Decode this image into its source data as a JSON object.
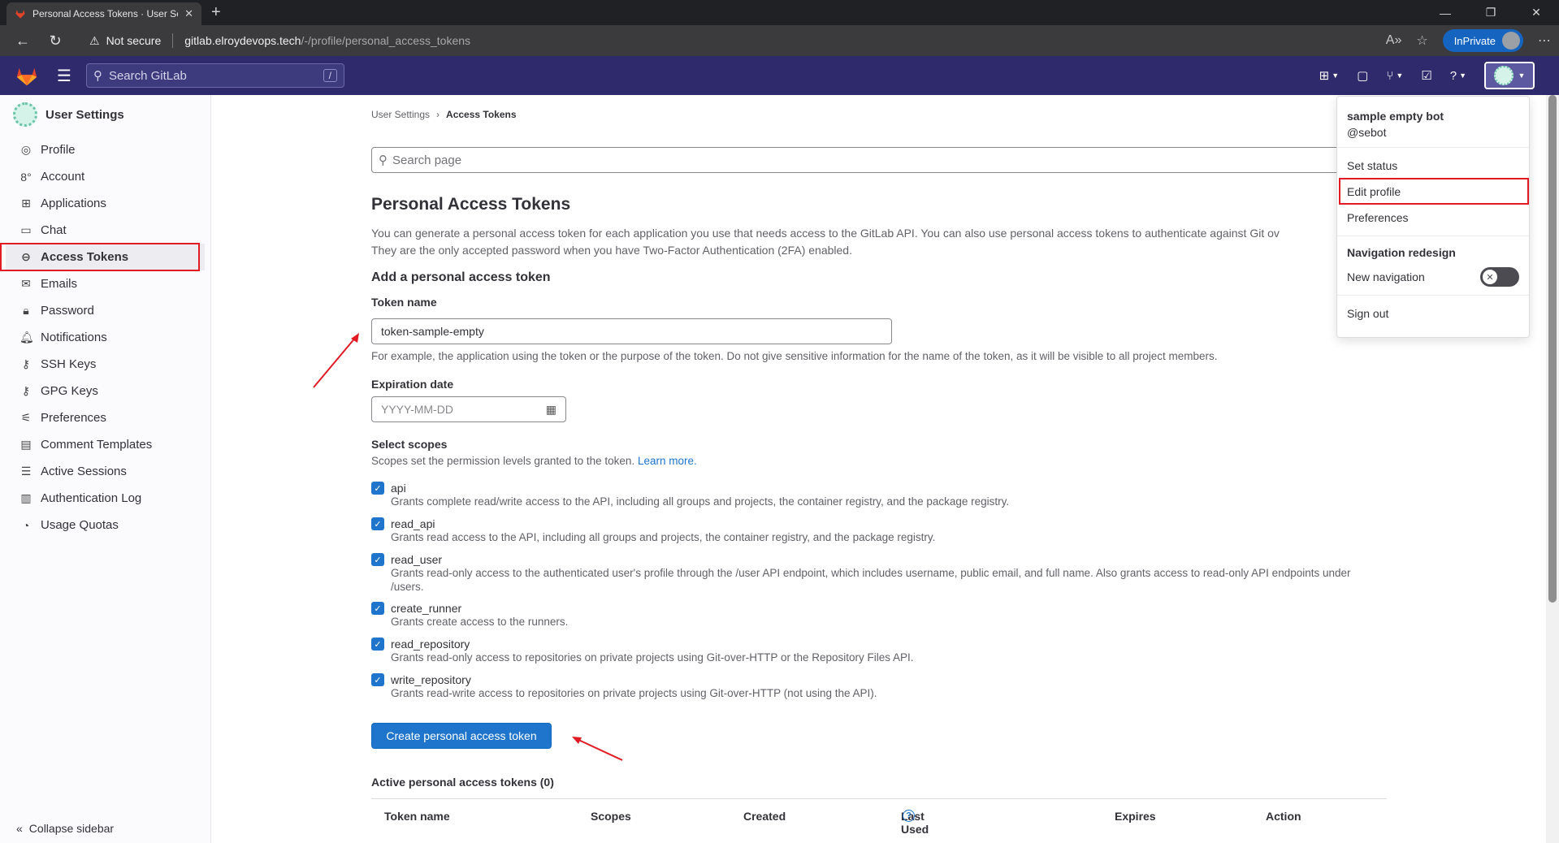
{
  "browser": {
    "tab_title": "Personal Access Tokens · User Se",
    "security_label": "Not secure",
    "url_host": "gitlab.elroydevops.tech",
    "url_path": "/-/profile/personal_access_tokens",
    "inprivate_label": "InPrivate"
  },
  "header": {
    "search_placeholder": "Search GitLab",
    "search_shortcut": "/"
  },
  "sidebar": {
    "title": "User Settings",
    "items": [
      {
        "label": "Profile",
        "icon": "user-icon"
      },
      {
        "label": "Account",
        "icon": "account-icon"
      },
      {
        "label": "Applications",
        "icon": "applications-icon"
      },
      {
        "label": "Chat",
        "icon": "chat-icon"
      },
      {
        "label": "Access Tokens",
        "icon": "token-icon"
      },
      {
        "label": "Emails",
        "icon": "mail-icon"
      },
      {
        "label": "Password",
        "icon": "lock-icon"
      },
      {
        "label": "Notifications",
        "icon": "bell-icon"
      },
      {
        "label": "SSH Keys",
        "icon": "key-icon"
      },
      {
        "label": "GPG Keys",
        "icon": "key-icon"
      },
      {
        "label": "Preferences",
        "icon": "preferences-icon"
      },
      {
        "label": "Comment Templates",
        "icon": "comment-icon"
      },
      {
        "label": "Active Sessions",
        "icon": "sessions-icon"
      },
      {
        "label": "Authentication Log",
        "icon": "log-icon"
      },
      {
        "label": "Usage Quotas",
        "icon": "quota-icon"
      }
    ],
    "collapse_label": "Collapse sidebar"
  },
  "breadcrumb": {
    "parent": "User Settings",
    "current": "Access Tokens"
  },
  "page": {
    "search_placeholder": "Search page",
    "title": "Personal Access Tokens",
    "intro_line1": "You can generate a personal access token for each application you use that needs access to the GitLab API. You can also use personal access tokens to authenticate against Git ov",
    "intro_line2": "They are the only accepted password when you have Two-Factor Authentication (2FA) enabled.",
    "add_title": "Add a personal access token",
    "token_name_label": "Token name",
    "token_name_value": "token-sample-empty",
    "token_name_help": "For example, the application using the token or the purpose of the token. Do not give sensitive information for the name of the token, as it will be visible to all project members.",
    "expiration_label": "Expiration date",
    "expiration_placeholder": "YYYY-MM-DD",
    "scopes_label": "Select scopes",
    "scopes_help": "Scopes set the permission levels granted to the token.",
    "learn_more": "Learn more.",
    "scopes": [
      {
        "name": "api",
        "desc": "Grants complete read/write access to the API, including all groups and projects, the container registry, and the package registry.",
        "checked": true
      },
      {
        "name": "read_api",
        "desc": "Grants read access to the API, including all groups and projects, the container registry, and the package registry.",
        "checked": true
      },
      {
        "name": "read_user",
        "desc": "Grants read-only access to the authenticated user's profile through the /user API endpoint, which includes username, public email, and full name. Also grants access to read-only API endpoints under /users.",
        "checked": true
      },
      {
        "name": "create_runner",
        "desc": "Grants create access to the runners.",
        "checked": true
      },
      {
        "name": "read_repository",
        "desc": "Grants read-only access to repositories on private projects using Git-over-HTTP or the Repository Files API.",
        "checked": true
      },
      {
        "name": "write_repository",
        "desc": "Grants read-write access to repositories on private projects using Git-over-HTTP (not using the API).",
        "checked": true
      }
    ],
    "create_button": "Create personal access token",
    "active_title": "Active personal access tokens (0)",
    "table_headers": [
      "Token name",
      "Scopes",
      "Created",
      "Last Used",
      "Expires",
      "Action"
    ]
  },
  "user_menu": {
    "name": "sample empty bot",
    "handle": "@sebot",
    "set_status": "Set status",
    "edit_profile": "Edit profile",
    "preferences": "Preferences",
    "nav_section": "Navigation redesign",
    "new_navigation": "New navigation",
    "new_navigation_enabled": false,
    "sign_out": "Sign out"
  },
  "colors": {
    "header_bg": "#2f2a6b",
    "primary": "#1f75cb",
    "highlight": "#e01b24"
  }
}
